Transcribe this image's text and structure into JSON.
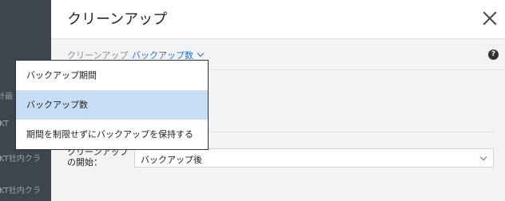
{
  "backdrop": {
    "lines": [
      "計画",
      "IKT",
      "IKT社内クラ",
      "IKT社内クラ"
    ]
  },
  "header": {
    "title": "クリーンアップ"
  },
  "breadcrumb": {
    "label": "クリーンアップ",
    "value": "バックアップ数"
  },
  "help": {
    "label": "?"
  },
  "dropdown": {
    "items": [
      {
        "label": "バックアップ期間",
        "selected": false
      },
      {
        "label": "バックアップ数",
        "selected": true
      },
      {
        "label": "期間を制限せずにバックアップを保持する",
        "selected": false
      }
    ]
  },
  "form": {
    "start_label": "クリーンアップの開始：",
    "start_value": "バックアップ後"
  },
  "colors": {
    "accent": "#2a74c4",
    "selection": "#c5def3"
  }
}
